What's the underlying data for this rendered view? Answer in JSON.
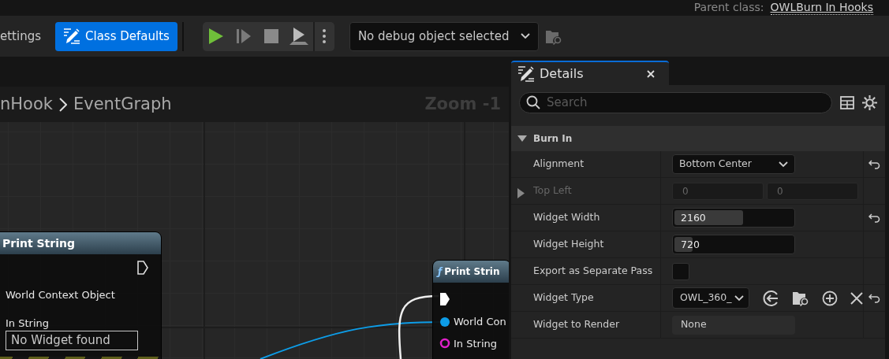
{
  "header": {
    "parent_class_label": "Parent class:",
    "parent_class": "OWLBurn In Hooks"
  },
  "toolbar": {
    "buttons": [
      {
        "label": "ettings",
        "kind": "plain",
        "selected": false
      },
      {
        "label": "Class Defaults",
        "kind": "defaults",
        "selected": true
      }
    ],
    "debug_object": "No debug object selected"
  },
  "graph": {
    "breadcrumb": [
      "nHook",
      "EventGraph"
    ],
    "zoom": "Zoom -1",
    "nodes": [
      {
        "title": "Print String",
        "kind": "collapsed_left",
        "pins": [
          {
            "label": "World Context Object"
          },
          {
            "label": "In String",
            "value": "No Widget found"
          }
        ]
      },
      {
        "title": "Print Strin",
        "kind": "function",
        "icon": "ƒ",
        "pins": [
          {
            "label": "World Con",
            "color": "#0d9de8"
          },
          {
            "label": "In String",
            "color": "#e020c8"
          }
        ]
      }
    ]
  },
  "details": {
    "tab": "Details",
    "search_placeholder": "Search",
    "category": {
      "label": "Burn In",
      "expanded": true
    },
    "properties": [
      {
        "label": "Alignment",
        "kind": "dropdown",
        "value": "Bottom Center",
        "resettable": true,
        "disabled": false
      },
      {
        "label": "Top Left",
        "kind": "pair",
        "values": [
          "0",
          "0"
        ],
        "expanded": false,
        "resettable": false,
        "disabled": true
      },
      {
        "label": "Widget Width",
        "kind": "slider",
        "value": "2160",
        "level": 0.58,
        "resettable": true,
        "disabled": false
      },
      {
        "label": "Widget Height",
        "kind": "slider",
        "value": "720",
        "level": 0.15,
        "resettable": false,
        "disabled": false
      },
      {
        "label": "Export as Separate Pass",
        "kind": "checkbox",
        "checked": false,
        "resettable": false,
        "disabled": false
      },
      {
        "label": "Widget Type",
        "kind": "asset",
        "value": "OWL_360_",
        "resettable": true,
        "disabled": false
      },
      {
        "label": "Widget to Render",
        "kind": "readonly",
        "value": "None",
        "resettable": false,
        "disabled": false
      }
    ]
  }
}
